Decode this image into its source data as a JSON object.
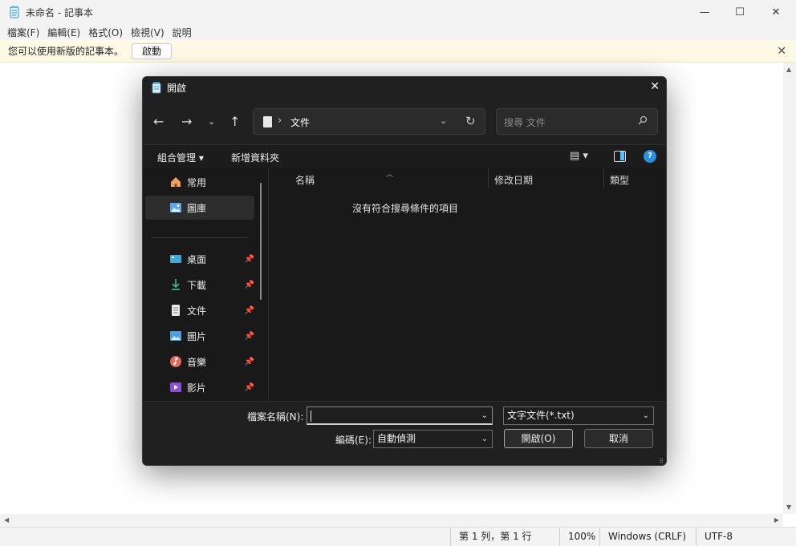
{
  "notepad": {
    "title": "未命名 - 記事本",
    "menu": [
      "檔案(F)",
      "編輯(E)",
      "格式(O)",
      "檢視(V)",
      "說明"
    ],
    "banner": {
      "text": "您可以使用新版的記事本。",
      "button": "啟動"
    },
    "status": {
      "position": "第 1 列，第 1 行",
      "zoom": "100%",
      "line_ending": "Windows (CRLF)",
      "encoding": "UTF-8"
    }
  },
  "dialog": {
    "title": "開啟",
    "address": {
      "current": "文件"
    },
    "search": {
      "placeholder": "搜尋 文件"
    },
    "commands": {
      "organize": "組合管理 ▾",
      "new_folder": "新增資料夾"
    },
    "nav": {
      "items": [
        {
          "label": "常用"
        },
        {
          "label": "圖庫"
        },
        {
          "label": "桌面"
        },
        {
          "label": "下載"
        },
        {
          "label": "文件"
        },
        {
          "label": "圖片"
        },
        {
          "label": "音樂"
        },
        {
          "label": "影片"
        }
      ],
      "selected": "圖庫"
    },
    "files": {
      "columns": [
        "名稱",
        "修改日期",
        "類型"
      ],
      "empty_message": "沒有符合搜尋條件的項目"
    },
    "bottom": {
      "filename_label": "檔案名稱(N):",
      "filename_value": "",
      "filetype_value": "文字文件(*.txt)",
      "encoding_label": "編碼(E):",
      "encoding_value": "自動偵測",
      "open_button": "開啟(O)",
      "cancel_button": "取消"
    }
  },
  "colors": {
    "accent": "#4cc2ff",
    "dialog_bg": "#202020",
    "banner_bg": "#fdf9e5"
  }
}
